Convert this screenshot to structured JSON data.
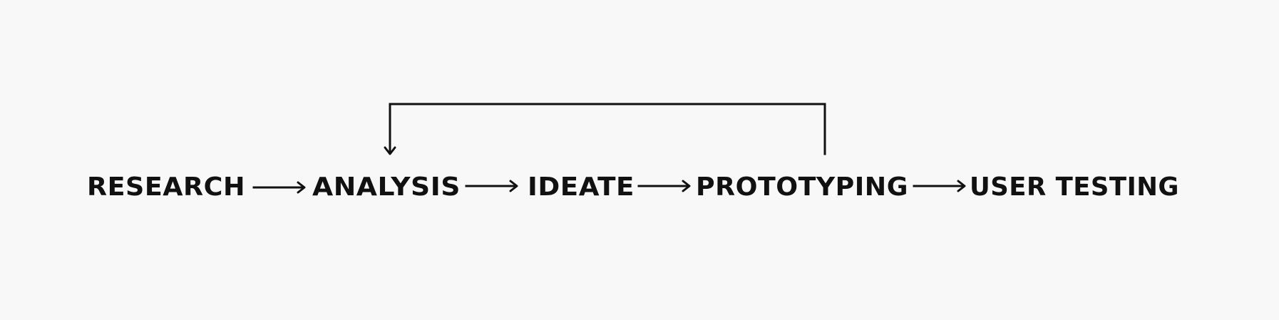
{
  "diagram": {
    "type": "process-flow",
    "colors": {
      "background": "#f8f8f8",
      "ink": "#111111"
    },
    "steps": [
      {
        "id": "research",
        "label": "RESEARCH"
      },
      {
        "id": "analysis",
        "label": "ANALYSIS"
      },
      {
        "id": "ideate",
        "label": "IDEATE"
      },
      {
        "id": "prototyping",
        "label": "PROTOTYPING"
      },
      {
        "id": "user-testing",
        "label": "USER TESTING"
      }
    ],
    "flows": [
      {
        "from": "research",
        "to": "analysis"
      },
      {
        "from": "analysis",
        "to": "ideate"
      },
      {
        "from": "ideate",
        "to": "prototyping"
      },
      {
        "from": "prototyping",
        "to": "user-testing"
      },
      {
        "from": "prototyping",
        "to": "analysis",
        "kind": "feedback-loop"
      }
    ]
  }
}
